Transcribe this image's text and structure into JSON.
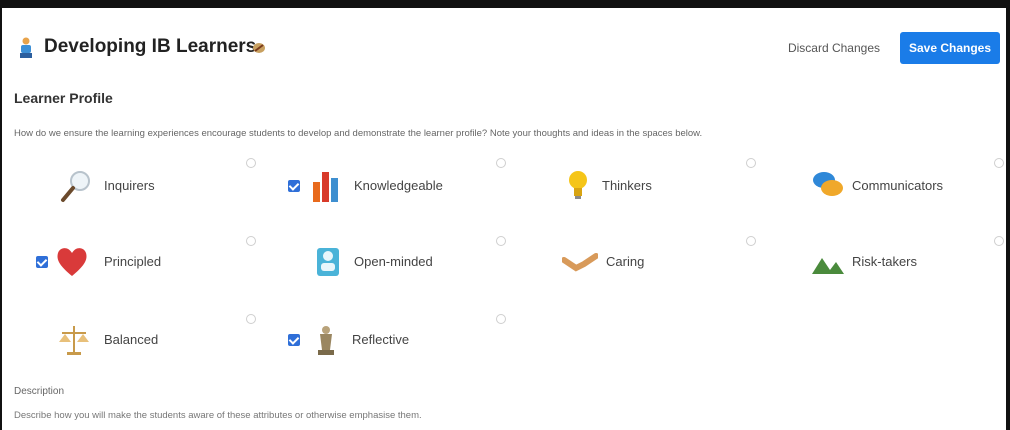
{
  "header": {
    "title": "Developing IB Learners",
    "discard_label": "Discard Changes",
    "save_label": "Save Changes"
  },
  "section": {
    "title": "Learner Profile",
    "prompt": "How do we ensure the learning experiences encourage students to develop and demonstrate the learner profile? Note your thoughts and ideas in the spaces below."
  },
  "attributes": [
    {
      "label": "Inquirers",
      "checked": false,
      "icon": "magnifier-icon"
    },
    {
      "label": "Knowledgeable",
      "checked": true,
      "icon": "bar-chart-icon"
    },
    {
      "label": "Thinkers",
      "checked": false,
      "icon": "lightbulb-icon"
    },
    {
      "label": "Communicators",
      "checked": false,
      "icon": "speech-bubbles-icon"
    },
    {
      "label": "Principled",
      "checked": true,
      "icon": "heart-icon"
    },
    {
      "label": "Open-minded",
      "checked": false,
      "icon": "person-icon"
    },
    {
      "label": "Caring",
      "checked": false,
      "icon": "handshake-icon"
    },
    {
      "label": "Risk-takers",
      "checked": false,
      "icon": "mountains-icon"
    },
    {
      "label": "Balanced",
      "checked": false,
      "icon": "scales-icon"
    },
    {
      "label": "Reflective",
      "checked": true,
      "icon": "thinker-statue-icon"
    }
  ],
  "description": {
    "title": "Description",
    "text": "Describe how you will make the students aware of these attributes or otherwise emphasise them."
  },
  "colors": {
    "accent": "#1a7ce8",
    "checkbox": "#2f6fd8"
  }
}
